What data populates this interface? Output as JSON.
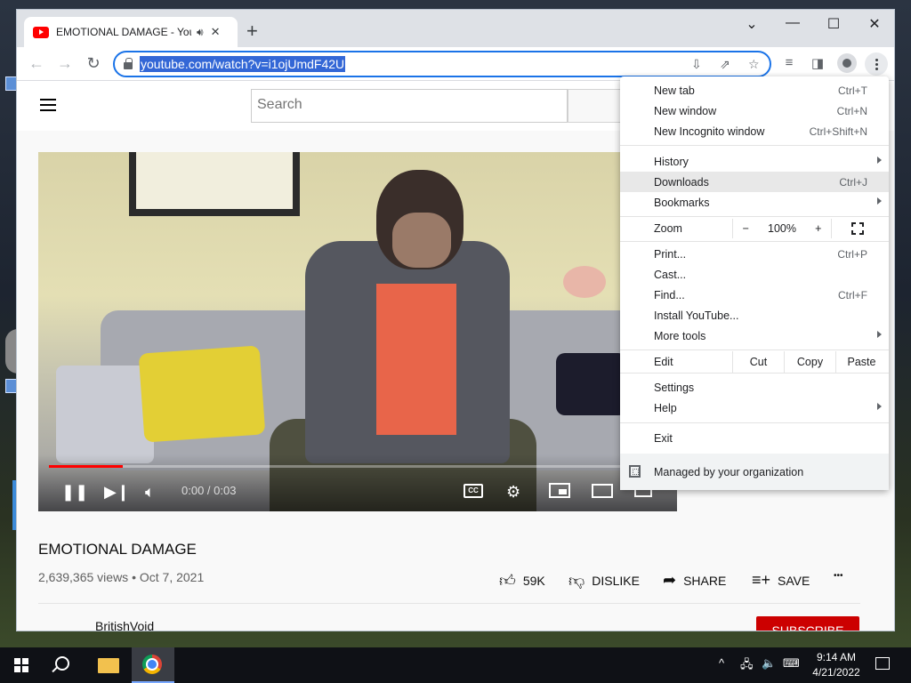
{
  "browser": {
    "tab": {
      "title": "EMOTIONAL DAMAGE - YouTube",
      "audio_icon": "speaker-icon",
      "close_glyph": "✕"
    },
    "new_tab_glyph": "+",
    "window_controls": {
      "tablist": "⌄",
      "minimize": "—",
      "maximize": "☐",
      "close": "✕"
    },
    "nav": {
      "back": "←",
      "forward": "→",
      "reload": "↻"
    },
    "url": "youtube.com/watch?v=i1ojUmdF42U"
  },
  "youtube": {
    "search_placeholder": "Search",
    "player": {
      "time": "0:00 / 0:03",
      "progress": 0.12,
      "cc_label": "CC"
    },
    "video": {
      "title": "EMOTIONAL DAMAGE",
      "views": "2,639,365 views",
      "date": "Oct 7, 2021",
      "meta_separator": "•",
      "likes": "59K",
      "dislike_label": "DISLIKE",
      "share_label": "SHARE",
      "save_label": "SAVE",
      "more_glyph": "•••"
    },
    "channel": {
      "name": "BritishVoid",
      "subscribe_label": "SUBSCRIBE"
    }
  },
  "menu": {
    "items": [
      {
        "label": "New tab",
        "shortcut": "Ctrl+T"
      },
      {
        "label": "New window",
        "shortcut": "Ctrl+N"
      },
      {
        "label": "New Incognito window",
        "shortcut": "Ctrl+Shift+N"
      },
      {
        "label": "History",
        "shortcut": ""
      },
      {
        "label": "Downloads",
        "shortcut": "Ctrl+J"
      },
      {
        "label": "Bookmarks",
        "shortcut": ""
      },
      {
        "label": "Print...",
        "shortcut": "Ctrl+P"
      },
      {
        "label": "Cast...",
        "shortcut": ""
      },
      {
        "label": "Find...",
        "shortcut": "Ctrl+F"
      },
      {
        "label": "Install YouTube...",
        "shortcut": ""
      },
      {
        "label": "More tools",
        "shortcut": ""
      },
      {
        "label": "Settings",
        "shortcut": ""
      },
      {
        "label": "Help",
        "shortcut": ""
      },
      {
        "label": "Exit",
        "shortcut": ""
      }
    ],
    "zoom": {
      "label": "Zoom",
      "minus": "−",
      "value": "100%",
      "plus": "+"
    },
    "edit": {
      "label": "Edit",
      "cut": "Cut",
      "copy": "Copy",
      "paste": "Paste"
    },
    "managed": "Managed by your organization",
    "highlighted_item": "Downloads"
  },
  "taskbar": {
    "time": "9:14 AM",
    "date": "4/21/2022",
    "tray": {
      "chevron": "^",
      "network_icon": "network-icon",
      "volume_glyph": "🔈",
      "keyboard_icon": "keyboard-icon"
    }
  }
}
